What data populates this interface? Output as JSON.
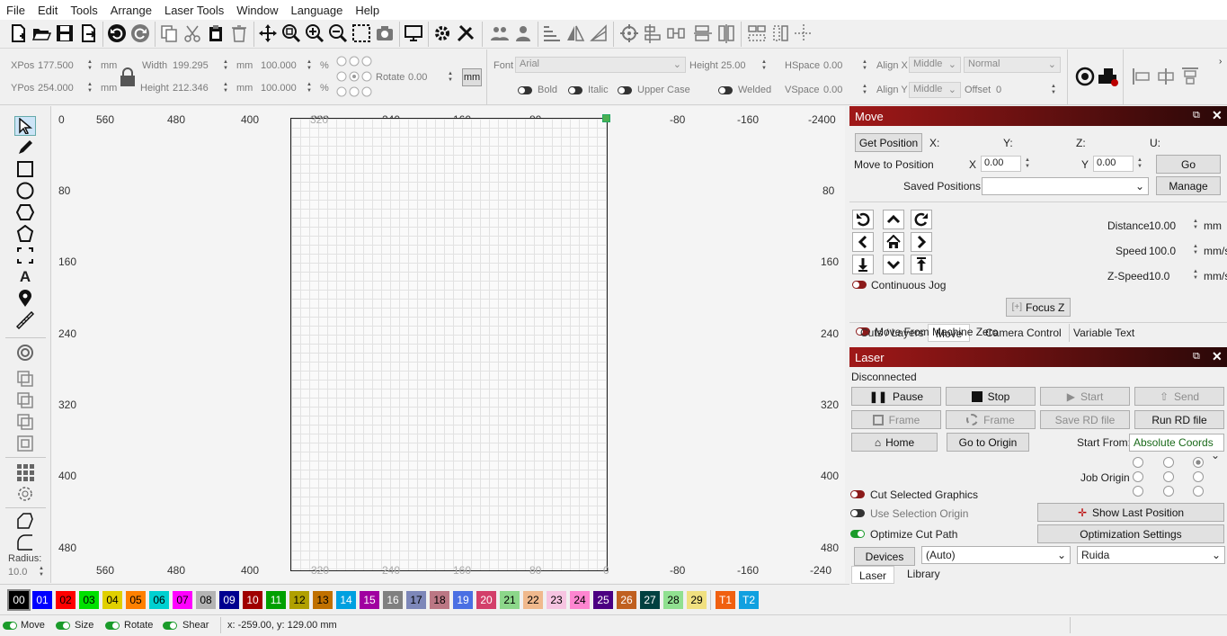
{
  "menu": [
    "File",
    "Edit",
    "Tools",
    "Arrange",
    "Laser Tools",
    "Window",
    "Language",
    "Help"
  ],
  "toolbar": {
    "icons": [
      "new-file-icon",
      "open-folder-icon",
      "save-icon",
      "import-icon",
      "undo-icon",
      "redo-icon",
      "copy-icon",
      "cut-icon",
      "paste-icon",
      "delete-icon",
      "move-icon",
      "zoom-fit-icon",
      "zoom-in-icon",
      "zoom-out-icon",
      "select-frame-icon",
      "camera-icon",
      "monitor-icon",
      "settings-icon",
      "tools-icon",
      "group-icon",
      "ungroup-icon",
      "mirror-h-icon",
      "mirror-v-icon",
      "rotate-icon",
      "target-icon",
      "align-icon",
      "distribute-icon",
      "spacing-icon",
      "dock-icon",
      "grid-snap-icon"
    ]
  },
  "props": {
    "xpos_label": "XPos",
    "xpos": "177.500",
    "ypos_label": "YPos",
    "ypos": "254.000",
    "unit": "mm",
    "width_label": "Width",
    "width": "199.295",
    "height_label": "Height",
    "height": "212.346",
    "wpct": "100.000",
    "hpct": "100.000",
    "pct": "%",
    "rotate_label": "Rotate",
    "rotate": "0.00",
    "mm_button": "mm",
    "font_label": "Font",
    "font": "Arial",
    "fheight_label": "Height",
    "fheight": "25.00",
    "hspace_label": "HSpace",
    "hspace": "0.00",
    "vspace_label": "VSpace",
    "vspace": "0.00",
    "alignx_label": "Align X",
    "alignx": "Middle",
    "aligny_label": "Align Y",
    "aligny": "Middle",
    "style": "Normal",
    "offset_label": "Offset",
    "offset": "0",
    "bold": "Bold",
    "italic": "Italic",
    "upper": "Upper Case",
    "welded": "Welded"
  },
  "left_tools": {
    "radius_label": "Radius:",
    "radius": "10.0"
  },
  "rulers": {
    "top": [
      "560",
      "480",
      "400",
      "320",
      "240",
      "160",
      "80",
      "0",
      "-80",
      "-160",
      "-2400"
    ],
    "bottom": [
      "560",
      "480",
      "400",
      "320",
      "240",
      "160",
      "80",
      "0",
      "-80",
      "-160",
      "-240"
    ],
    "left": [
      "0",
      "80",
      "160",
      "240",
      "320",
      "400",
      "480"
    ],
    "right": [
      "80",
      "160",
      "240",
      "320",
      "400",
      "480"
    ]
  },
  "move": {
    "title": "Move",
    "get_position": "Get Position",
    "x": "X:",
    "y": "Y:",
    "z": "Z:",
    "u": "U:",
    "move_to": "Move to Position",
    "mx_label": "X",
    "mx": "0.00",
    "my_label": "Y",
    "my": "0.00",
    "go": "Go",
    "saved": "Saved Positions:",
    "manage": "Manage",
    "distance_label": "Distance",
    "distance": "10.00",
    "distance_unit": "mm",
    "speed_label": "Speed",
    "speed": "100.0",
    "speed_unit": "mm/s",
    "zspeed_label": "Z-Speed",
    "zspeed": "10.0",
    "zspeed_unit": "mm/s",
    "continuous": "Continuous Jog",
    "focus": "Focus Z",
    "from_zero": "Move From Machine Zero",
    "tabs": [
      "Cuts / Layers",
      "Move",
      "Camera Control",
      "Variable Text"
    ]
  },
  "laser": {
    "title": "Laser",
    "status": "Disconnected",
    "pause": "Pause",
    "stop": "Stop",
    "start": "Start",
    "send": "Send",
    "frame1": "Frame",
    "frame2": "Frame",
    "save_rd": "Save RD file",
    "run_rd": "Run RD file",
    "home": "Home",
    "go_origin": "Go to Origin",
    "start_from_label": "Start From:",
    "start_from": "Absolute Coords",
    "job_origin": "Job Origin",
    "cut_selected": "Cut Selected Graphics",
    "use_sel_origin": "Use Selection Origin",
    "optimize": "Optimize Cut Path",
    "show_last": "Show Last Position",
    "opt_settings": "Optimization Settings",
    "devices": "Devices",
    "device": "(Auto)",
    "controller": "Ruida",
    "tabs": [
      "Laser",
      "Library"
    ]
  },
  "palette": [
    {
      "n": "00",
      "c": "#000000",
      "t": "#ffffff"
    },
    {
      "n": "01",
      "c": "#0000ff",
      "t": "#ffffff"
    },
    {
      "n": "02",
      "c": "#ff0000",
      "t": "#000000"
    },
    {
      "n": "03",
      "c": "#00e000",
      "t": "#000000"
    },
    {
      "n": "04",
      "c": "#e0d000",
      "t": "#000000"
    },
    {
      "n": "05",
      "c": "#ff8000",
      "t": "#000000"
    },
    {
      "n": "06",
      "c": "#00d0d0",
      "t": "#000000"
    },
    {
      "n": "07",
      "c": "#ff00ff",
      "t": "#000000"
    },
    {
      "n": "08",
      "c": "#b4b4b4",
      "t": "#000000"
    },
    {
      "n": "09",
      "c": "#000090",
      "t": "#ffffff"
    },
    {
      "n": "10",
      "c": "#a00000",
      "t": "#ffffff"
    },
    {
      "n": "11",
      "c": "#00a000",
      "t": "#ffffff"
    },
    {
      "n": "12",
      "c": "#b0a000",
      "t": "#000000"
    },
    {
      "n": "13",
      "c": "#c07000",
      "t": "#000000"
    },
    {
      "n": "14",
      "c": "#00a0e0",
      "t": "#ffffff"
    },
    {
      "n": "15",
      "c": "#a000a0",
      "t": "#ffffff"
    },
    {
      "n": "16",
      "c": "#808080",
      "t": "#ffffff"
    },
    {
      "n": "17",
      "c": "#7d87b9",
      "t": "#000000"
    },
    {
      "n": "18",
      "c": "#bb7784",
      "t": "#000000"
    },
    {
      "n": "19",
      "c": "#4a6fe3",
      "t": "#ffffff"
    },
    {
      "n": "20",
      "c": "#d33f6a",
      "t": "#ffffff"
    },
    {
      "n": "21",
      "c": "#8cd78a",
      "t": "#000000"
    },
    {
      "n": "22",
      "c": "#f0b98d",
      "t": "#000000"
    },
    {
      "n": "23",
      "c": "#f6c4e1",
      "t": "#000000"
    },
    {
      "n": "24",
      "c": "#fe85d0",
      "t": "#000000"
    },
    {
      "n": "25",
      "c": "#4b0082",
      "t": "#ffffff"
    },
    {
      "n": "26",
      "c": "#c06020",
      "t": "#ffffff"
    },
    {
      "n": "27",
      "c": "#004040",
      "t": "#ffffff"
    },
    {
      "n": "28",
      "c": "#90e090",
      "t": "#000000"
    },
    {
      "n": "29",
      "c": "#f0e080",
      "t": "#000000"
    },
    {
      "n": "T1",
      "c": "#f06010",
      "t": "#ffffff"
    },
    {
      "n": "T2",
      "c": "#10a0e0",
      "t": "#ffffff"
    }
  ],
  "status": {
    "move": "Move",
    "size": "Size",
    "rotate": "Rotate",
    "shear": "Shear",
    "coords": "x: -259.00, y: 129.00 mm"
  }
}
